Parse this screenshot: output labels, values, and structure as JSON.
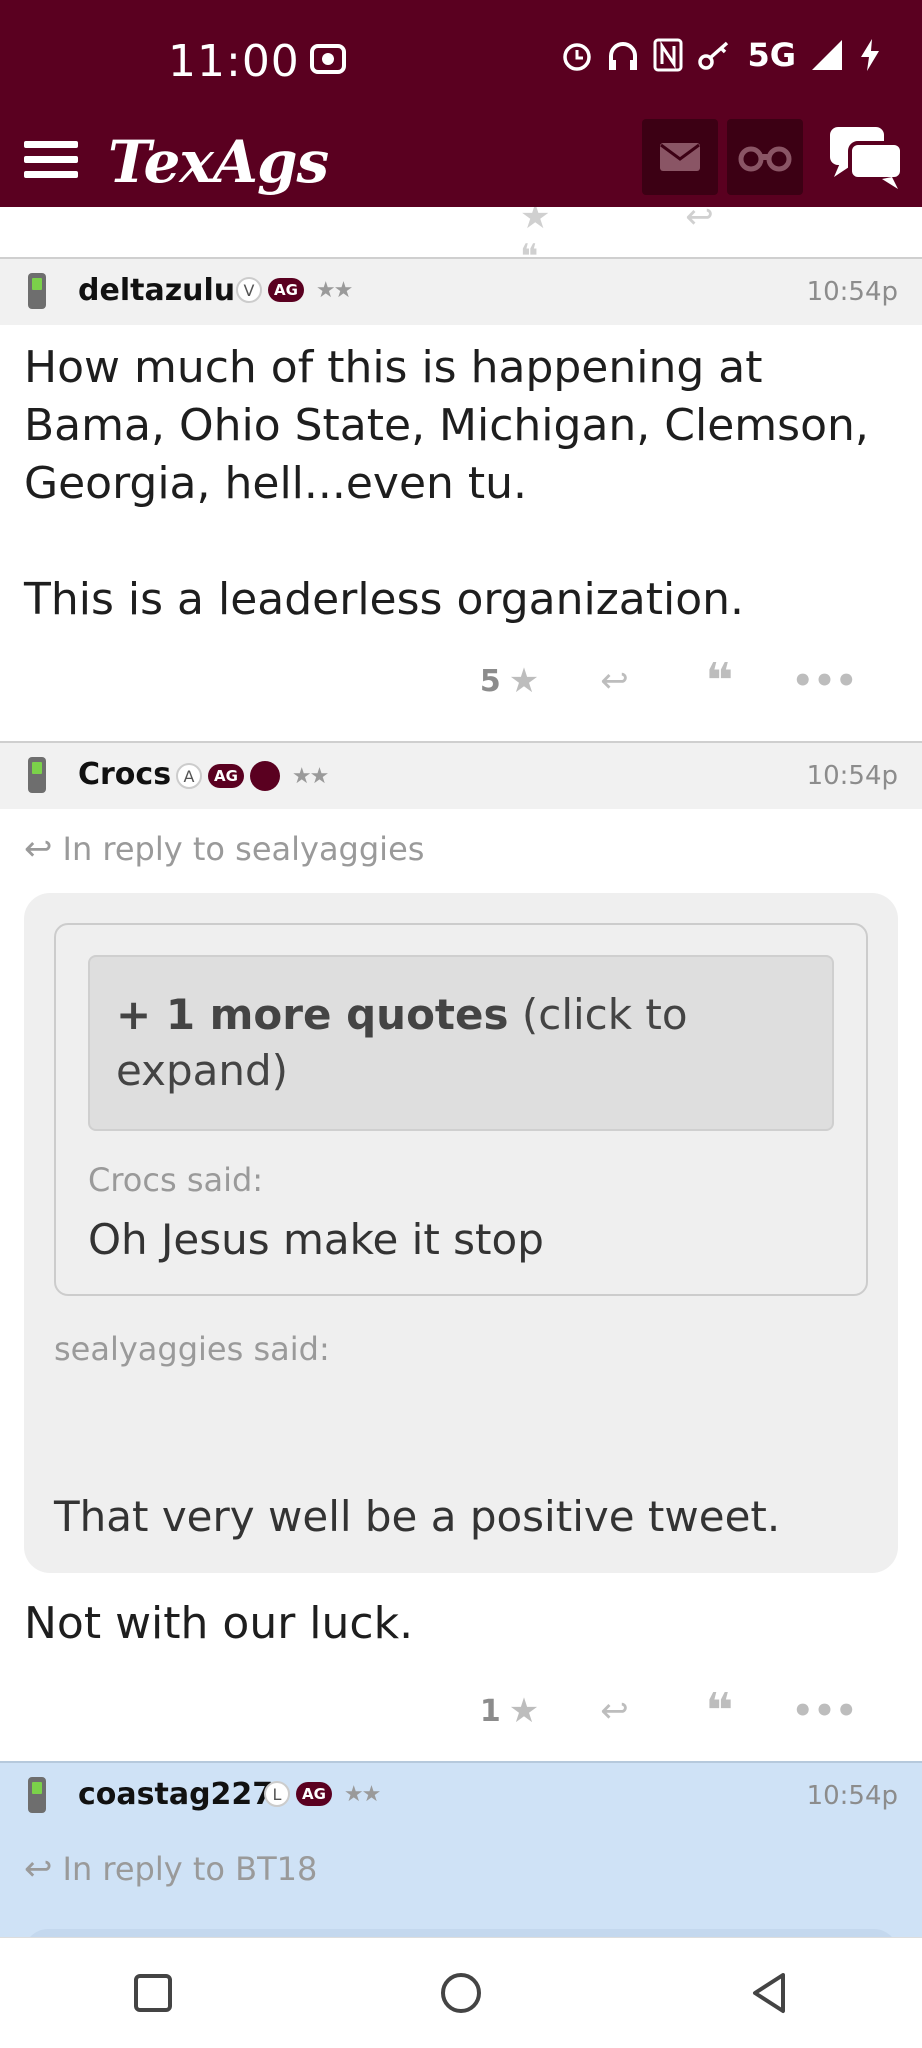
{
  "status": {
    "time": "11:00",
    "network": "5G"
  },
  "header": {
    "logo": "TexAgs"
  },
  "posts": [
    {
      "username": "deltazulu",
      "badge1": "V",
      "badge_ag": "AG",
      "stars": "★★",
      "time": "10:54p",
      "body1": "How much of this is happening at Bama, Ohio State, Michigan, Clemson, Georgia, hell...even tu.",
      "body2": "This is a leaderless organization.",
      "likes": "5"
    },
    {
      "username": "Crocs",
      "badge1": "A",
      "badge_ag": "AG",
      "stars": "★★",
      "time": "10:54p",
      "reply_to": "In reply to sealyaggies",
      "more_quotes_bold": "+ 1 more quotes",
      "more_quotes_rest": " (click to expand)",
      "inner_said": "Crocs said:",
      "inner_text": "Oh Jesus make it stop",
      "outer_said": "sealyaggies said:",
      "outer_text": "That very well be a positive tweet.",
      "body": "Not with our luck.",
      "likes": "1"
    },
    {
      "username": "coastag227",
      "badge1": "L",
      "badge_ag": "AG",
      "stars": "★★",
      "time": "10:54p",
      "reply_to": "In reply to BT18"
    }
  ]
}
